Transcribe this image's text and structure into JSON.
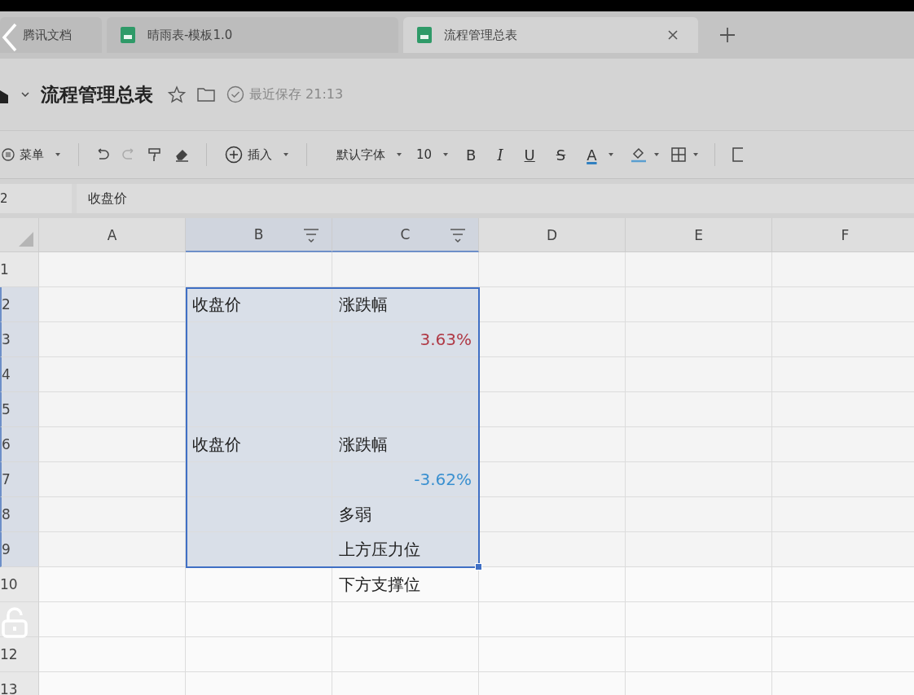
{
  "tabs": [
    {
      "label": "腾讯文档",
      "selected": false,
      "kind": "home"
    },
    {
      "label": "晴雨表-模板1.0",
      "selected": false,
      "kind": "sheet"
    },
    {
      "label": "流程管理总表",
      "selected": true,
      "kind": "sheet"
    }
  ],
  "doc": {
    "title": "流程管理总表",
    "save_status": "最近保存 21:13"
  },
  "toolbar": {
    "menu": "菜单",
    "insert": "插入",
    "font": "默认字体",
    "font_size": "10",
    "bold": "B",
    "italic": "I",
    "underline": "U",
    "strike": "S",
    "font_color": "A"
  },
  "formula_bar": {
    "cell_ref": "2",
    "value": "收盘价"
  },
  "grid": {
    "columns": [
      {
        "label": "A",
        "selected": false,
        "filter": false
      },
      {
        "label": "B",
        "selected": true,
        "filter": true
      },
      {
        "label": "C",
        "selected": true,
        "filter": true
      },
      {
        "label": "D",
        "selected": false,
        "filter": false
      },
      {
        "label": "E",
        "selected": false,
        "filter": false
      },
      {
        "label": "F",
        "selected": false,
        "filter": false
      }
    ],
    "rows": [
      {
        "label": "1",
        "selected": false,
        "cells": []
      },
      {
        "label": "2",
        "selected": true,
        "cells": [
          {},
          {
            "text": "收盘价"
          },
          {
            "text": "涨跌幅"
          }
        ]
      },
      {
        "label": "3",
        "selected": true,
        "cells": [
          {},
          {},
          {
            "text": "3.63%",
            "color": "#b03a46"
          }
        ]
      },
      {
        "label": "4",
        "selected": true,
        "cells": []
      },
      {
        "label": "5",
        "selected": true,
        "cells": []
      },
      {
        "label": "6",
        "selected": true,
        "cells": [
          {},
          {
            "text": "收盘价"
          },
          {
            "text": "涨跌幅"
          }
        ]
      },
      {
        "label": "7",
        "selected": true,
        "cells": [
          {},
          {},
          {
            "text": "-3.62%",
            "color": "#3a90d0"
          }
        ]
      },
      {
        "label": "8",
        "selected": true,
        "cells": [
          {},
          {},
          {
            "text": "多弱"
          }
        ]
      },
      {
        "label": "9",
        "selected": true,
        "cells": [
          {},
          {},
          {
            "text": "上方压力位"
          }
        ]
      },
      {
        "label": "10",
        "selected": false,
        "cells": [
          {},
          {},
          {
            "text": "下方支撑位"
          }
        ]
      },
      {
        "selected": false,
        "cells": []
      },
      {
        "label": "12",
        "selected": false,
        "cells": []
      },
      {
        "label": "13",
        "selected": false,
        "cells": []
      }
    ]
  }
}
